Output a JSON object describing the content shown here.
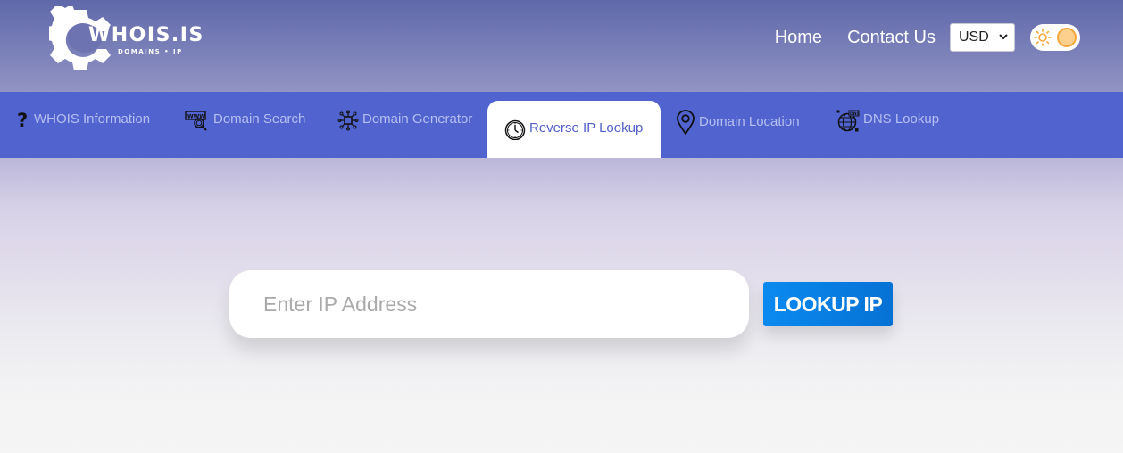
{
  "brand": {
    "title": "WHOIS.IS",
    "subtitle": "DOMAINS • IP"
  },
  "top_nav": {
    "home": "Home",
    "contact": "Contact Us",
    "currency": {
      "selected": "USD",
      "caret": "⌄"
    },
    "theme_toggle": {
      "mode": "light",
      "icon": "sun-icon"
    }
  },
  "tabs": [
    {
      "label": "WHOIS Information",
      "icon": "question-mark-icon",
      "active": false
    },
    {
      "label": "Domain Search",
      "icon": "www-search-icon",
      "active": false
    },
    {
      "label": "Domain Generator",
      "icon": "network-chip-icon",
      "active": false
    },
    {
      "label": "Reverse IP Lookup",
      "icon": "clock-icon",
      "active": true
    },
    {
      "label": "Domain Location",
      "icon": "map-pin-icon",
      "active": false
    },
    {
      "label": "DNS Lookup",
      "icon": "dns-globe-icon",
      "active": false
    }
  ],
  "search": {
    "value": "",
    "placeholder": "Enter IP Address",
    "button_label": "LOOKUP IP"
  },
  "colors": {
    "nav_band": "#5063cf",
    "tab_text": "#b7bff0",
    "active_tab_text": "#5060c8",
    "button": "#0a8af0",
    "toggle_knob": "#f7a73a"
  }
}
